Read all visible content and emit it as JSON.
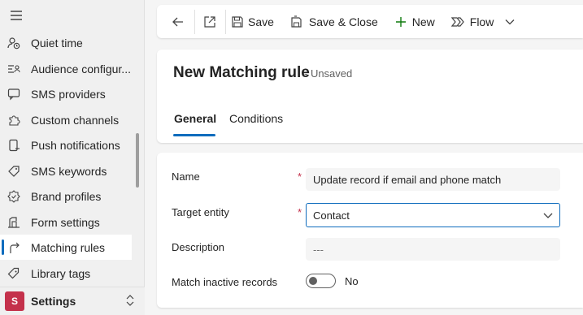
{
  "sidebar": {
    "items": [
      {
        "label": "Quiet time",
        "icon": "person-clock-icon"
      },
      {
        "label": "Audience configur...",
        "icon": "audience-list-icon"
      },
      {
        "label": "SMS providers",
        "icon": "chat-icon"
      },
      {
        "label": "Custom channels",
        "icon": "puzzle-icon"
      },
      {
        "label": "Push notifications",
        "icon": "mobile-notification-icon"
      },
      {
        "label": "SMS keywords",
        "icon": "tag-icon"
      },
      {
        "label": "Brand profiles",
        "icon": "badge-icon"
      },
      {
        "label": "Form settings",
        "icon": "form-icon"
      },
      {
        "label": "Matching rules",
        "icon": "arrow-route-icon",
        "active": true
      },
      {
        "label": "Library tags",
        "icon": "tag-outline-icon"
      }
    ],
    "area": {
      "badge": "S",
      "label": "Settings",
      "badge_color": "#c4314b"
    }
  },
  "commandbar": {
    "save_label": "Save",
    "save_close_label": "Save & Close",
    "new_label": "New",
    "flow_label": "Flow"
  },
  "record": {
    "title": "New Matching rule",
    "status": "- Unsaved"
  },
  "tabs": [
    {
      "label": "General",
      "active": true
    },
    {
      "label": "Conditions",
      "active": false
    }
  ],
  "form": {
    "name_label": "Name",
    "name_value": "Update record if email and phone match",
    "target_label": "Target entity",
    "target_value": "Contact",
    "description_label": "Description",
    "description_value": "---",
    "inactive_label": "Match inactive records",
    "inactive_value": "No",
    "required_mark": "*"
  },
  "colors": {
    "accent": "#0f6cbd",
    "required": "#c4314b",
    "new_icon": "#0e7a0d"
  }
}
